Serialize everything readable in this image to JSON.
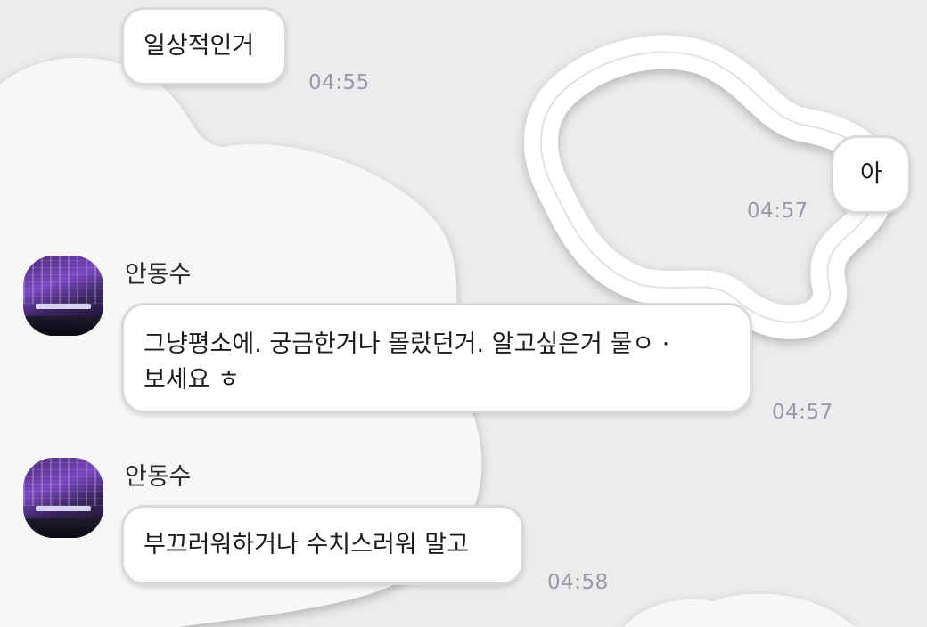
{
  "colors": {
    "background": "#ececee",
    "bubble": "#ffffff",
    "bubble_border": "#d9d9dc",
    "timestamp": "#9a9aa0"
  },
  "messages": [
    {
      "type": "incoming",
      "text": "일상적인거",
      "time": "04:55"
    },
    {
      "type": "outgoing",
      "text": "아",
      "time": "04:57"
    },
    {
      "type": "incoming",
      "sender": "안동수",
      "avatar": "concert-hall-photo",
      "lines": [
        "그냥평소에. 궁금한거나 몰랐던거. 알고싶은거 물ㅇ ·",
        "보세요 ㅎ"
      ],
      "time": "04:57"
    },
    {
      "type": "incoming",
      "sender": "안동수",
      "avatar": "concert-hall-photo",
      "text": "부끄러워하거나 수치스러워 말고",
      "time": "04:58"
    }
  ]
}
